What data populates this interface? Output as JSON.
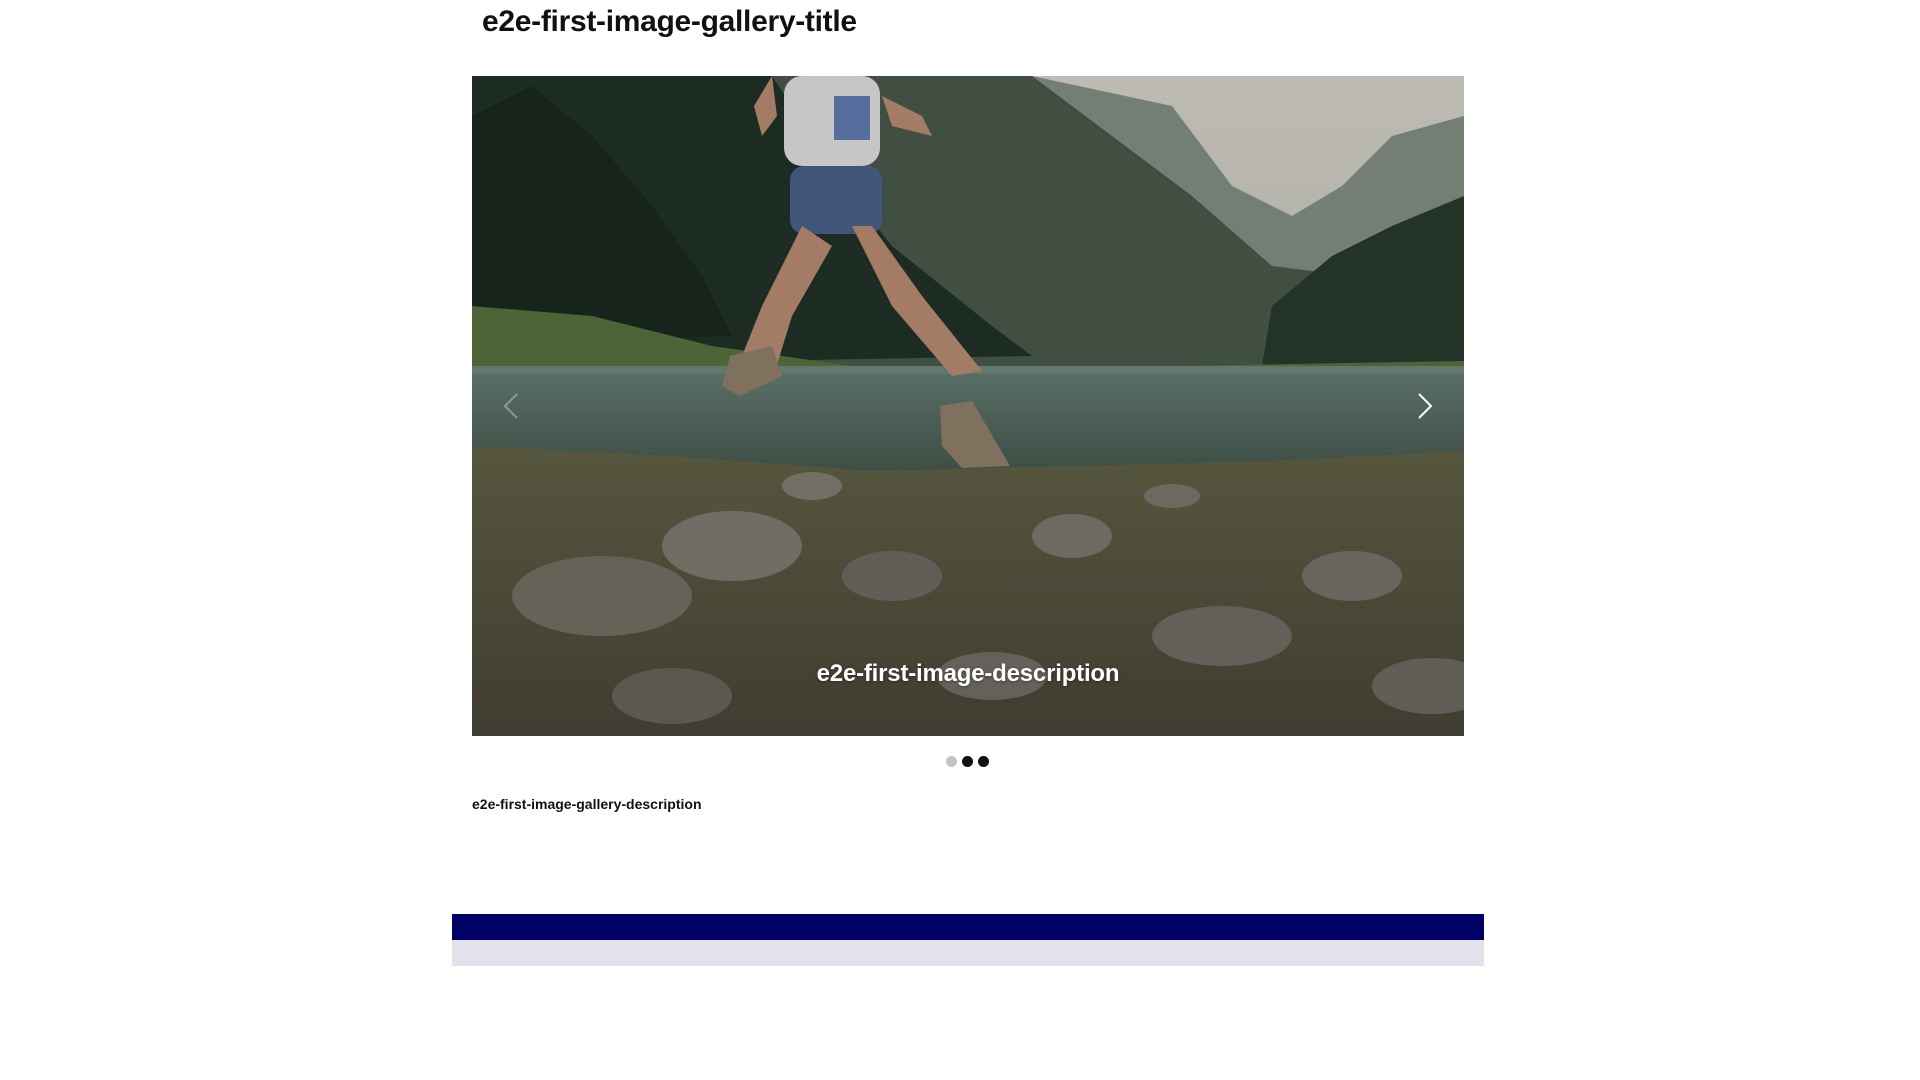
{
  "gallery": {
    "title": "e2e-first-image-gallery-title",
    "description": "e2e-first-image-gallery-description",
    "slides": [
      {
        "caption": "e2e-first-image-description"
      }
    ],
    "active_slide_index": 1,
    "slide_count": 3,
    "prev_icon": "chevron-left-icon",
    "next_icon": "chevron-right-icon"
  },
  "colors": {
    "dot_active": "#c4c4c4",
    "dot_inactive": "#111111",
    "footer_dark": "#000066",
    "footer_light": "#e2e2ec"
  }
}
